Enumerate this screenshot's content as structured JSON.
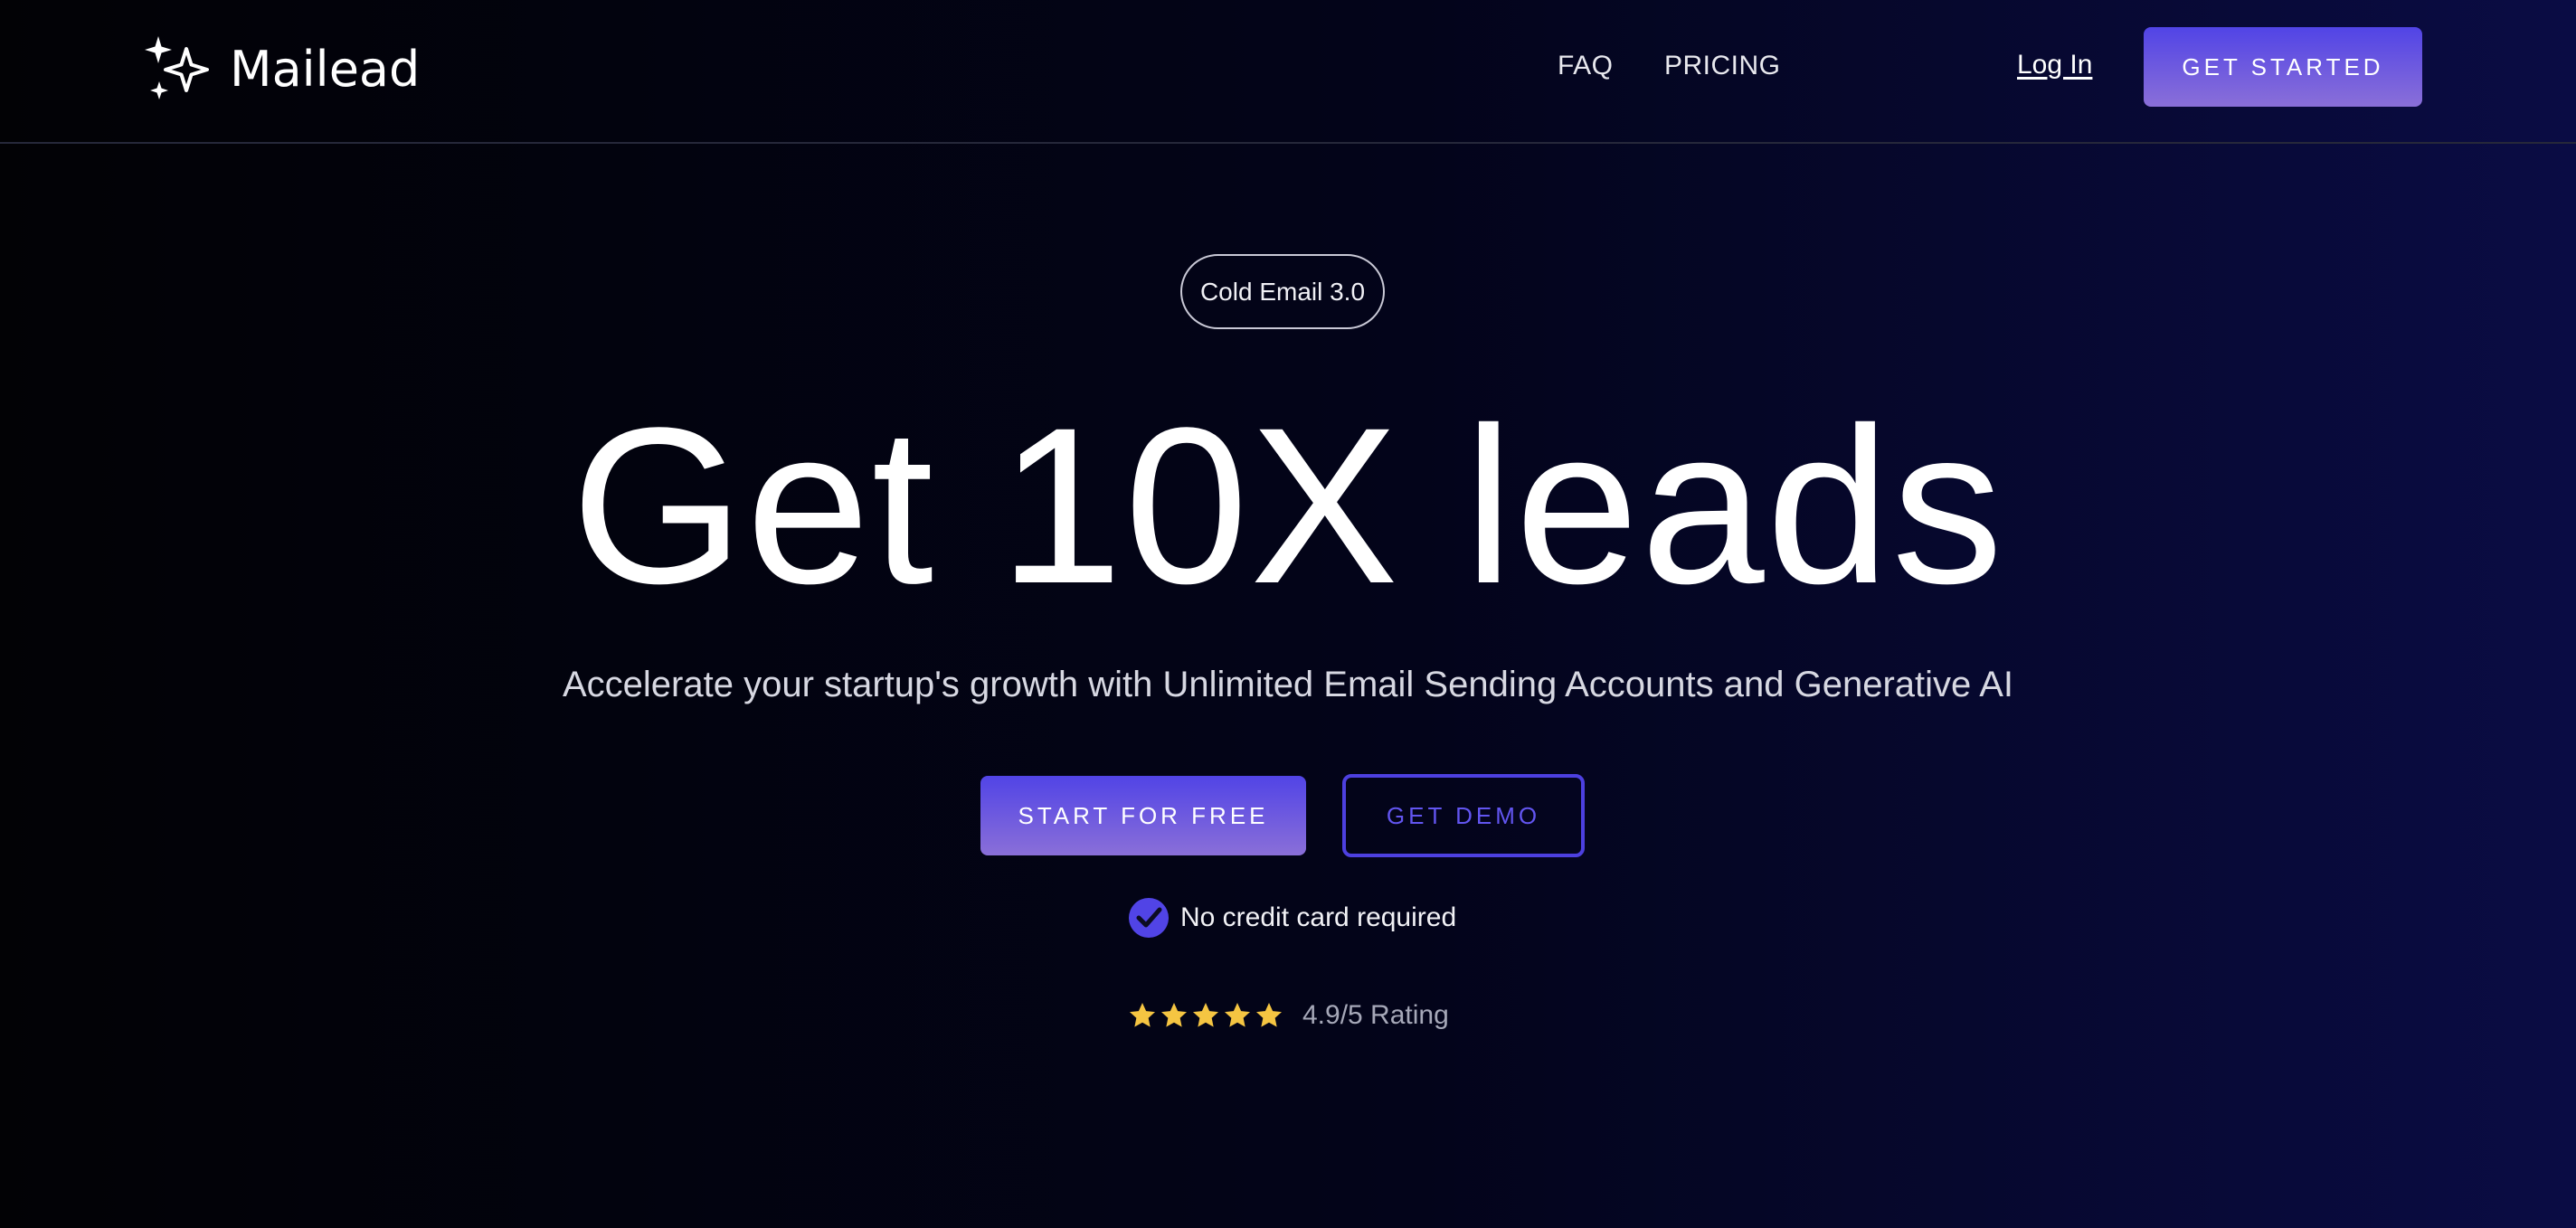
{
  "nav": {
    "brand": "Mailead",
    "brand_icon": "sparkles-icon",
    "links": [
      "FAQ",
      "PRICING"
    ],
    "login_label": "Log In",
    "cta_label": "GET STARTED"
  },
  "hero": {
    "badge": "Cold Email 3.0",
    "headline": "Get 10X leads",
    "subheadline": "Accelerate your startup's growth with Unlimited Email Sending Accounts and Generative AI",
    "primary_cta": "START FOR FREE",
    "secondary_cta": "GET DEMO",
    "note": "No credit card required",
    "note_icon": "check-circle-icon",
    "rating_stars": 5,
    "rating_text": "4.9/5 Rating"
  },
  "colors": {
    "accent": "#5144e6",
    "accent_light": "#8a6fd8",
    "star": "#f5c542",
    "background_dark": "#020205",
    "background_navy": "#0a0c44"
  }
}
